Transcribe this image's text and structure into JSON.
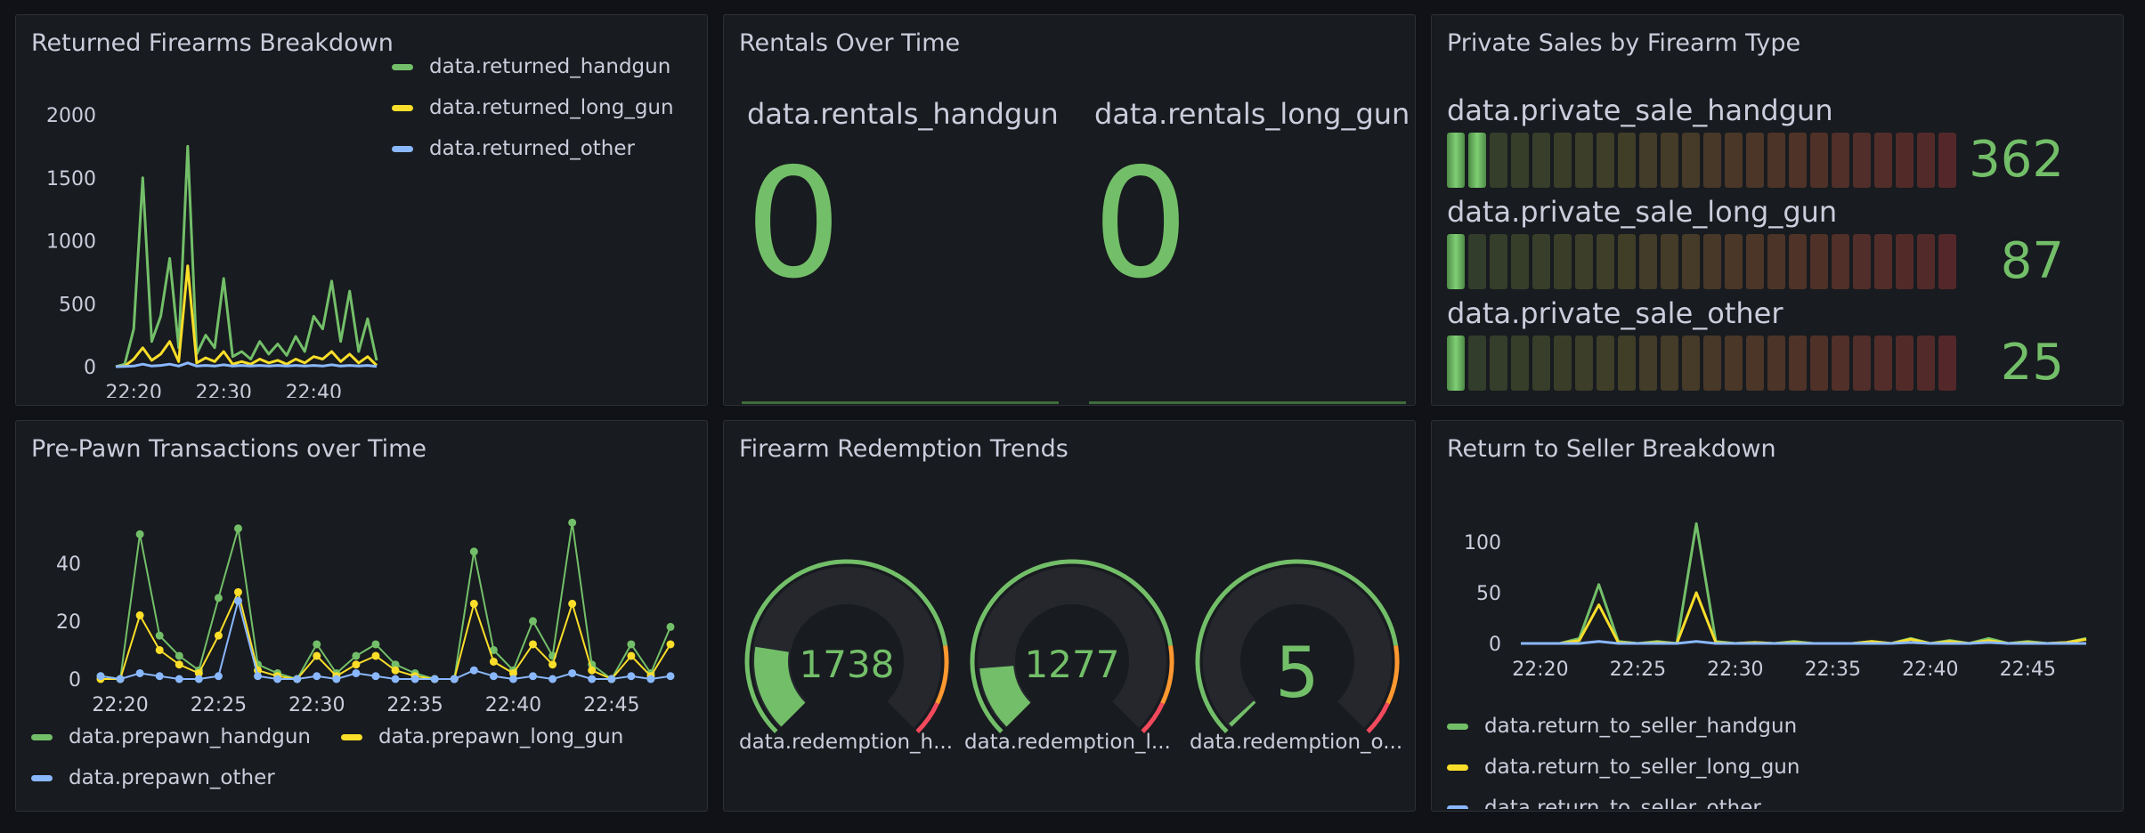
{
  "panels": {
    "returned": {
      "title": "Returned Firearms Breakdown",
      "legend": [
        {
          "label": "data.returned_handgun",
          "color": "#73bf69"
        },
        {
          "label": "data.returned_long_gun",
          "color": "#fade2a"
        },
        {
          "label": "data.returned_other",
          "color": "#8ab8ff"
        }
      ],
      "chart_data": {
        "type": "line",
        "y_ticks": [
          "2000",
          "1500",
          "1000",
          "500",
          "0"
        ],
        "x_ticks": [
          "22:20",
          "22:30",
          "22:40"
        ],
        "ylim": [
          0,
          2000
        ],
        "x": [
          "22:18",
          "22:19",
          "22:20",
          "22:21",
          "22:22",
          "22:23",
          "22:24",
          "22:25",
          "22:26",
          "22:27",
          "22:28",
          "22:29",
          "22:30",
          "22:31",
          "22:32",
          "22:33",
          "22:34",
          "22:35",
          "22:36",
          "22:37",
          "22:38",
          "22:39",
          "22:40",
          "22:41",
          "22:42",
          "22:43",
          "22:44",
          "22:45",
          "22:46",
          "22:47"
        ],
        "series": [
          {
            "name": "data.returned_handgun",
            "color": "#73bf69",
            "values": [
              0,
              20,
              300,
              1500,
              200,
              400,
              860,
              150,
              1750,
              100,
              250,
              150,
              700,
              80,
              120,
              60,
              200,
              100,
              180,
              90,
              240,
              120,
              400,
              300,
              680,
              200,
              600,
              120,
              380,
              50
            ]
          },
          {
            "name": "data.returned_long_gun",
            "color": "#fade2a",
            "values": [
              0,
              5,
              60,
              150,
              50,
              100,
              200,
              40,
              800,
              30,
              70,
              40,
              120,
              20,
              40,
              20,
              60,
              30,
              50,
              20,
              60,
              30,
              80,
              60,
              120,
              40,
              100,
              30,
              80,
              10
            ]
          },
          {
            "name": "data.returned_other",
            "color": "#8ab8ff",
            "values": [
              0,
              2,
              5,
              20,
              5,
              10,
              20,
              5,
              30,
              5,
              10,
              5,
              15,
              5,
              10,
              5,
              10,
              5,
              10,
              5,
              10,
              5,
              10,
              5,
              15,
              5,
              10,
              5,
              10,
              2
            ]
          }
        ]
      }
    },
    "rentals": {
      "title": "Rentals Over Time",
      "stats": [
        {
          "label": "data.rentals_handgun",
          "value": "0"
        },
        {
          "label": "data.rentals_long_gun",
          "value": "0"
        }
      ]
    },
    "private_sales": {
      "title": "Private Sales by Firearm Type",
      "rows": [
        {
          "label": "data.private_sale_handgun",
          "value": "362",
          "fraction": 0.09
        },
        {
          "label": "data.private_sale_long_gun",
          "value": "87",
          "fraction": 0.04
        },
        {
          "label": "data.private_sale_other",
          "value": "25",
          "fraction": 0.04
        }
      ]
    },
    "prepawn": {
      "title": "Pre-Pawn Transactions over Time",
      "legend": [
        {
          "label": "data.prepawn_handgun",
          "color": "#73bf69"
        },
        {
          "label": "data.prepawn_long_gun",
          "color": "#fade2a"
        },
        {
          "label": "data.prepawn_other",
          "color": "#8ab8ff"
        }
      ],
      "chart_data": {
        "type": "line",
        "y_ticks": [
          "40",
          "20",
          "0"
        ],
        "x_ticks": [
          "22:20",
          "22:25",
          "22:30",
          "22:35",
          "22:40",
          "22:45"
        ],
        "ylim": [
          0,
          55
        ],
        "x": [
          "22:19",
          "22:20",
          "22:21",
          "22:22",
          "22:23",
          "22:24",
          "22:25",
          "22:26",
          "22:27",
          "22:28",
          "22:29",
          "22:30",
          "22:31",
          "22:32",
          "22:33",
          "22:34",
          "22:35",
          "22:36",
          "22:37",
          "22:38",
          "22:39",
          "22:40",
          "22:41",
          "22:42",
          "22:43",
          "22:44",
          "22:45",
          "22:46",
          "22:47",
          "22:48"
        ],
        "series": [
          {
            "name": "data.prepawn_handgun",
            "color": "#73bf69",
            "values": [
              1,
              0,
              50,
              15,
              8,
              3,
              28,
              52,
              5,
              2,
              0,
              12,
              2,
              8,
              12,
              5,
              2,
              0,
              0,
              44,
              10,
              3,
              20,
              8,
              54,
              5,
              0,
              12,
              2,
              18
            ]
          },
          {
            "name": "data.prepawn_long_gun",
            "color": "#fade2a",
            "values": [
              0,
              0,
              22,
              10,
              5,
              2,
              15,
              30,
              3,
              1,
              0,
              8,
              1,
              5,
              8,
              3,
              1,
              0,
              0,
              26,
              6,
              2,
              12,
              5,
              26,
              3,
              0,
              8,
              1,
              12
            ]
          },
          {
            "name": "data.prepawn_other",
            "color": "#8ab8ff",
            "values": [
              1,
              0,
              2,
              1,
              0,
              0,
              1,
              27,
              1,
              0,
              0,
              1,
              0,
              2,
              1,
              0,
              0,
              0,
              0,
              3,
              1,
              0,
              1,
              0,
              2,
              0,
              0,
              1,
              0,
              1
            ]
          }
        ]
      }
    },
    "redemption": {
      "title": "Firearm Redemption Trends",
      "gauges": [
        {
          "label": "data.redemption_h...",
          "value": "1738",
          "fraction": 0.2
        },
        {
          "label": "data.redemption_l...",
          "value": "1277",
          "fraction": 0.15
        },
        {
          "label": "data.redemption_o...",
          "value": "5",
          "fraction": 0.01
        }
      ]
    },
    "return_seller": {
      "title": "Return to Seller Breakdown",
      "legend": [
        {
          "label": "data.return_to_seller_handgun",
          "color": "#73bf69"
        },
        {
          "label": "data.return_to_seller_long_gun",
          "color": "#fade2a"
        },
        {
          "label": "data.return_to_seller_other",
          "color": "#8ab8ff"
        }
      ],
      "chart_data": {
        "type": "line",
        "y_ticks": [
          "100",
          "50",
          "0"
        ],
        "x_ticks": [
          "22:20",
          "22:25",
          "22:30",
          "22:35",
          "22:40",
          "22:45"
        ],
        "ylim": [
          0,
          120
        ],
        "x": [
          "22:19",
          "22:20",
          "22:21",
          "22:22",
          "22:23",
          "22:24",
          "22:25",
          "22:26",
          "22:27",
          "22:28",
          "22:29",
          "22:30",
          "22:31",
          "22:32",
          "22:33",
          "22:34",
          "22:35",
          "22:36",
          "22:37",
          "22:38",
          "22:39",
          "22:40",
          "22:41",
          "22:42",
          "22:43",
          "22:44",
          "22:45",
          "22:46",
          "22:47",
          "22:48"
        ],
        "series": [
          {
            "name": "data.return_to_seller_handgun",
            "color": "#73bf69",
            "values": [
              0,
              0,
              0,
              5,
              58,
              2,
              0,
              2,
              0,
              118,
              2,
              0,
              1,
              0,
              2,
              0,
              0,
              0,
              2,
              0,
              5,
              0,
              3,
              0,
              5,
              0,
              2,
              0,
              1,
              5
            ]
          },
          {
            "name": "data.return_to_seller_long_gun",
            "color": "#fade2a",
            "values": [
              0,
              0,
              0,
              3,
              38,
              1,
              0,
              1,
              0,
              50,
              1,
              0,
              1,
              0,
              1,
              0,
              0,
              0,
              2,
              0,
              4,
              0,
              2,
              0,
              3,
              0,
              1,
              0,
              1,
              4
            ]
          },
          {
            "name": "data.return_to_seller_other",
            "color": "#8ab8ff",
            "values": [
              0,
              0,
              0,
              0,
              2,
              0,
              0,
              0,
              0,
              2,
              0,
              0,
              0,
              0,
              0,
              0,
              0,
              0,
              0,
              0,
              1,
              0,
              0,
              0,
              1,
              0,
              0,
              0,
              0,
              0
            ]
          }
        ]
      }
    }
  }
}
